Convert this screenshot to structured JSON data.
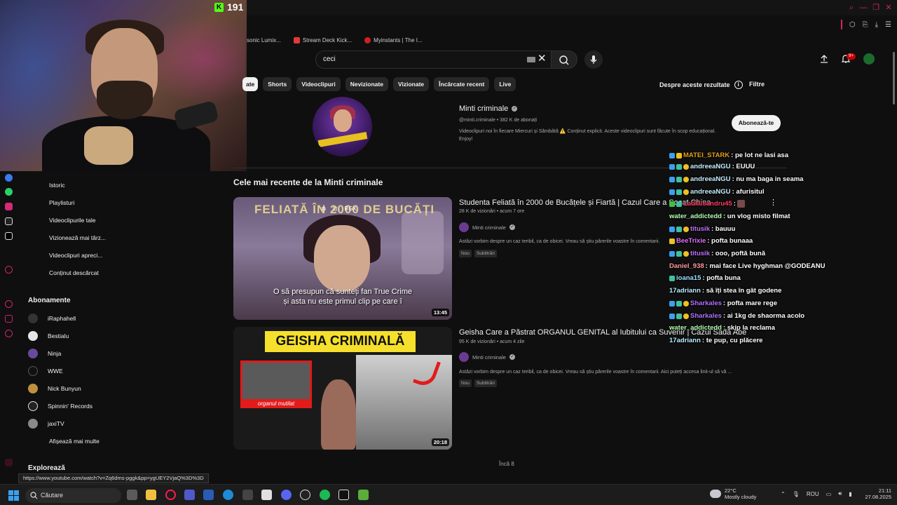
{
  "stream": {
    "viewer_count": "191"
  },
  "bookmarks": [
    {
      "label": "sonic Lumix...",
      "color": "#e23a3a"
    },
    {
      "label": "Stream Deck Kick...",
      "color": "#e23a3a"
    },
    {
      "label": "Myinstants | The I...",
      "color": "#d02020"
    }
  ],
  "search": {
    "query": "ceci"
  },
  "notifications": {
    "count": "9+"
  },
  "chips": [
    "ate",
    "Shorts",
    "Videoclipuri",
    "Nevizionate",
    "Vizionate",
    "Încărcate recent",
    "Live"
  ],
  "about_results": "Despre aceste rezultate",
  "filters": "Filtre",
  "channel": {
    "name": "Minti criminale",
    "meta": "@minti.criminale • 382 K de abonați",
    "description": "Videoclipuri noi în fiecare Miercuri și Sâmbătă ⚠️ Conținut explicit. Aceste videoclipuri sunt făcute în scop educațional. Enjoy!",
    "subscribe_label": "Abonează-te"
  },
  "sidebar": {
    "items": [
      "Istoric",
      "Playlisturi",
      "Videoclipurile tale",
      "Vizionează mai târz...",
      "Videoclipuri apreci...",
      "Conținut descărcat"
    ],
    "subscriptions_title": "Abonamente",
    "subscriptions": [
      {
        "name": "iRaphahell",
        "color": "#333333"
      },
      {
        "name": "Bestialu",
        "color": "#e6e6e6"
      },
      {
        "name": "Ninja",
        "color": "#6a4aa0"
      },
      {
        "name": "WWE",
        "color": "#111111"
      },
      {
        "name": "Nick Bunyun",
        "color": "#c09040"
      },
      {
        "name": "Spinnin' Records",
        "color": "#222222"
      },
      {
        "name": "jaxiTV",
        "color": "#8a8a8a"
      }
    ],
    "show_more": "Afișează mai multe",
    "explore_title": "Explorează"
  },
  "section_title": "Cele mai recente de la Minti criminale",
  "videos": [
    {
      "title": "Studenta Feliată în 2000 de Bucățele și Fiartă | Cazul Care a Șocat China",
      "meta": "28 K de vizionări • acum 7 ore",
      "channel": "Minti criminale",
      "description": "Astăzi vorbim despre un caz teribil, ca de obicei. Vreau să știu părerile voastre în comentarii.",
      "badges": [
        "Nou",
        "Subtitrări"
      ],
      "duration": "13:45",
      "thumb_title": "FELIATĂ ÎN 2000 DE BUCĂȚI",
      "caption_line1": "O să presupun că sunteți fan True Crime",
      "caption_line2": "și asta nu este primul clip pe care î",
      "overlay_icons": [
        "⧉",
        "⊡",
        "RGX"
      ]
    },
    {
      "title": "Geisha Care a Păstrat ORGANUL GENITAL al Iubitului ca Suvenir | Cazul Sada Abe",
      "meta": "95 K de vizionări • acum 4 zile",
      "channel": "Minti criminale",
      "description": "Astăzi vorbim despre un caz teribil, ca de obicei. Vreau să știu părerile voastre în comentarii. Aici puteți accesa link-ul să vă ...",
      "badges": [
        "Nou",
        "Subtitrări"
      ],
      "duration": "20:18",
      "thumb_title": "GEISHA CRIMINALĂ",
      "thumb_label": "organul mutilat"
    }
  ],
  "more_count": "Încă 8",
  "chat": [
    {
      "user": "MATEI_STARK",
      "message": ": pe lot ne lasi asa",
      "color": "#e0a020"
    },
    {
      "user": "andreeaNGU",
      "message": ": EUUU",
      "color": "#c6f0ff"
    },
    {
      "user": "andreeaNGU",
      "message": ": nu ma baga in seama",
      "color": "#c6f0ff"
    },
    {
      "user": "andreeaNGU",
      "message": ": afurisitul",
      "color": "#c6f0ff"
    },
    {
      "user": "Ladlaisandru45",
      "message": ":",
      "color": "#ff3a60"
    },
    {
      "user": "water_addictedd",
      "message": ": un vlog misto filmat",
      "color": "#b5ffb5"
    },
    {
      "user": "titusik",
      "message": ": bauuu",
      "color": "#c070ff"
    },
    {
      "user": "BeeTrixie",
      "message": ": pofta bunaaa",
      "color": "#e070ff"
    },
    {
      "user": "titusik",
      "message": ": ooo, poftă bună",
      "color": "#c070ff"
    },
    {
      "user": "Daniel_938",
      "message": ": mai face Live hyghman @GODEANU",
      "color": "#ff9aa0"
    },
    {
      "user": "ioana15",
      "message": ": pofta buna",
      "color": "#9ae0ff"
    },
    {
      "user": "17adriann",
      "message": ": să îți stea în gât godene",
      "color": "#b8f0ff"
    },
    {
      "user": "Sharkales",
      "message": ": pofta mare rege",
      "color": "#b070ff"
    },
    {
      "user": "Sharkales",
      "message": ": ai 1kg de shaorma acolo",
      "color": "#b070ff"
    },
    {
      "user": "water_addictedd",
      "message": ": skip la reclama",
      "color": "#b5ffb5"
    },
    {
      "user": "17adriann",
      "message": ": te pup, cu plăcere",
      "color": "#b8f0ff"
    }
  ],
  "status_url": "https://www.youtube.com/watch?v=Zq6dms-pggk&pp=ygUEY2VjaQ%3D%3D",
  "taskbar": {
    "search_label": "Căutare",
    "weather_temp": "22°C",
    "weather_desc": "Mostly cloudy",
    "language": "ROU",
    "time": "21:11",
    "date": "27.08.2025"
  }
}
